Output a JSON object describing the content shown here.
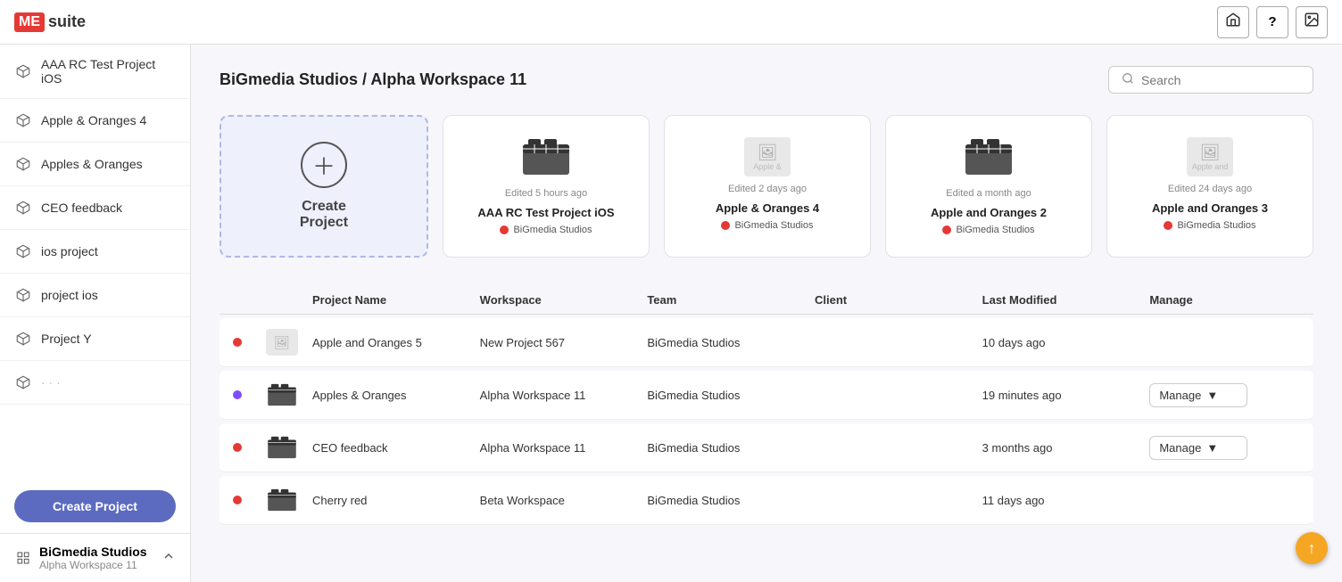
{
  "app": {
    "logo_me": "ME",
    "logo_suite": "suite"
  },
  "topbar": {
    "home_icon": "🏠",
    "help_icon": "?",
    "image_icon": "🖼"
  },
  "sidebar": {
    "items": [
      {
        "id": "aaa-rc",
        "label": "AAA RC Test Project iOS",
        "icon_type": "cube"
      },
      {
        "id": "apple-oranges-4",
        "label": "Apple & Oranges 4",
        "icon_type": "cube"
      },
      {
        "id": "apples-oranges",
        "label": "Apples & Oranges",
        "icon_type": "cube"
      },
      {
        "id": "ceo-feedback",
        "label": "CEO feedback",
        "icon_type": "cube"
      },
      {
        "id": "ios-project",
        "label": "ios project",
        "icon_type": "cube"
      },
      {
        "id": "project-ios",
        "label": "project ios",
        "icon_type": "cube"
      },
      {
        "id": "project-y",
        "label": "Project Y",
        "icon_type": "cube"
      },
      {
        "id": "project-more",
        "label": "...",
        "icon_type": "cube"
      }
    ],
    "create_button": "Create Project",
    "footer": {
      "title": "BiGmedia Studios",
      "subtitle": "Alpha Workspace 11"
    }
  },
  "header": {
    "breadcrumb": "BiGmedia Studios / Alpha Workspace 11",
    "search_placeholder": "Search"
  },
  "cards": [
    {
      "id": "create",
      "type": "create",
      "label1": "Create",
      "label2": "Project"
    },
    {
      "id": "aaa-rc",
      "type": "project",
      "title": "AAA RC Test Project iOS",
      "team": "BiGmedia Studios",
      "edited": "Edited 5 hours ago",
      "dot": "red",
      "img_type": "clapper"
    },
    {
      "id": "apple-oranges-4",
      "type": "project",
      "title": "Apple & Oranges 4",
      "team": "BiGmedia Studios",
      "edited": "Edited 2 days ago",
      "dot": "red",
      "img_type": "broken"
    },
    {
      "id": "apple-oranges-2",
      "type": "project",
      "title": "Apple and Oranges 2",
      "team": "BiGmedia Studios",
      "edited": "Edited a month ago",
      "dot": "red",
      "img_type": "clapper"
    },
    {
      "id": "apple-oranges-3",
      "type": "project",
      "title": "Apple and Oranges 3",
      "team": "BiGmedia Studios",
      "edited": "Edited 24 days ago",
      "dot": "red",
      "img_type": "broken"
    }
  ],
  "table": {
    "columns": [
      "",
      "",
      "Project Name",
      "Workspace",
      "Team",
      "Client",
      "Last Modified",
      "Manage"
    ],
    "rows": [
      {
        "id": "row-apple-5",
        "dot": "red",
        "img_type": "broken",
        "project_name": "Apple and Oranges 5",
        "workspace": "New Project 567",
        "team": "BiGmedia Studios",
        "client": "",
        "last_modified": "10 days ago",
        "manage": false
      },
      {
        "id": "row-apples-oranges",
        "dot": "purple",
        "img_type": "clapper",
        "project_name": "Apples & Oranges",
        "workspace": "Alpha Workspace 11",
        "team": "BiGmedia Studios",
        "client": "",
        "last_modified": "19 minutes ago",
        "manage": true
      },
      {
        "id": "row-ceo",
        "dot": "red",
        "img_type": "clapper",
        "project_name": "CEO feedback",
        "workspace": "Alpha Workspace 11",
        "team": "BiGmedia Studios",
        "client": "",
        "last_modified": "3 months ago",
        "manage": true
      },
      {
        "id": "row-cherry",
        "dot": "red",
        "img_type": "clapper",
        "project_name": "Cherry red",
        "workspace": "Beta Workspace",
        "team": "BiGmedia Studios",
        "client": "",
        "last_modified": "11 days ago",
        "manage": false
      }
    ],
    "manage_label": "Manage",
    "manage_arrow": "▼"
  }
}
